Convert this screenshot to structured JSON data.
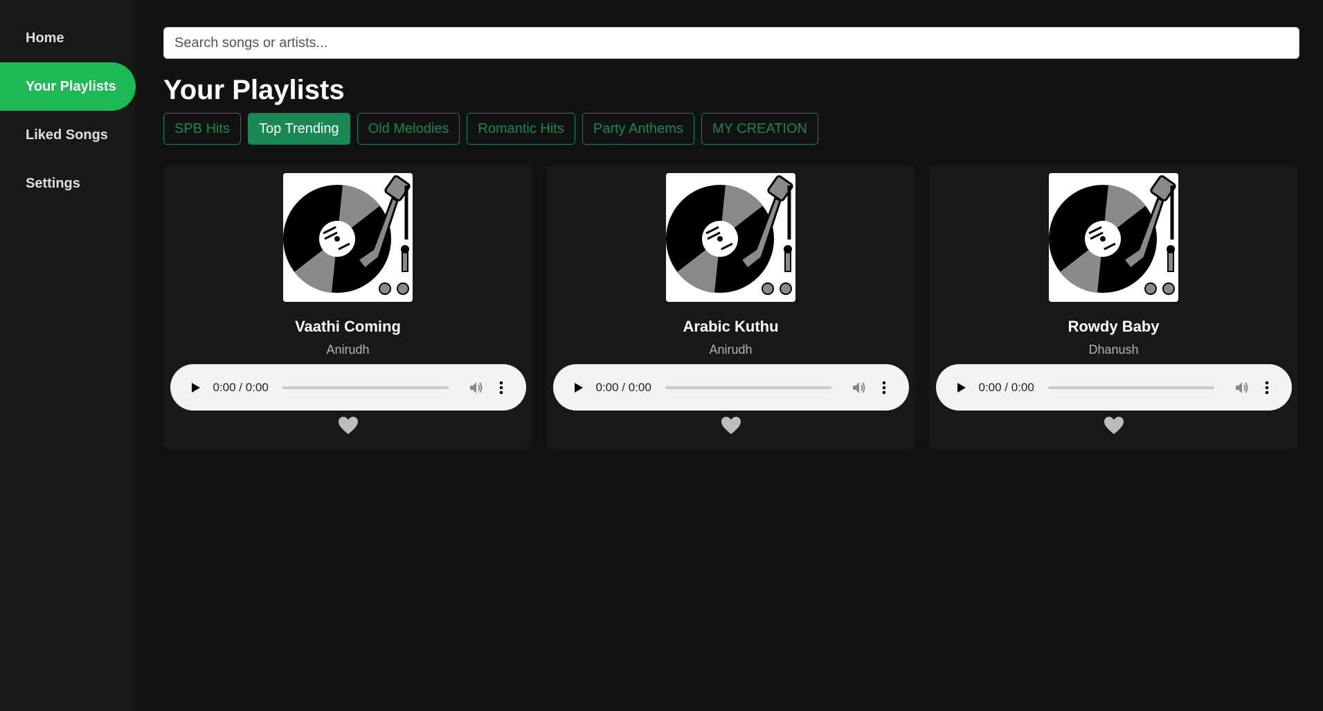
{
  "sidebar": {
    "items": [
      {
        "label": "Home",
        "active": false
      },
      {
        "label": "Your Playlists",
        "active": true
      },
      {
        "label": "Liked Songs",
        "active": false
      },
      {
        "label": "Settings",
        "active": false
      }
    ]
  },
  "search": {
    "placeholder": "Search songs or artists...",
    "value": ""
  },
  "page": {
    "title": "Your Playlists"
  },
  "playlists": [
    {
      "label": "SPB Hits",
      "active": false
    },
    {
      "label": "Top Trending",
      "active": true
    },
    {
      "label": "Old Melodies",
      "active": false
    },
    {
      "label": "Romantic Hits",
      "active": false
    },
    {
      "label": "Party Anthems",
      "active": false
    },
    {
      "label": "MY CREATION",
      "active": false
    }
  ],
  "songs": [
    {
      "title": "Vaathi Coming",
      "artist": "Anirudh",
      "time": "0:00 / 0:00",
      "cover_icon": "turntable-icon",
      "liked": false
    },
    {
      "title": "Arabic Kuthu",
      "artist": "Anirudh",
      "time": "0:00 / 0:00",
      "cover_icon": "turntable-icon",
      "liked": false
    },
    {
      "title": "Rowdy Baby",
      "artist": "Dhanush",
      "time": "0:00 / 0:00",
      "cover_icon": "turntable-icon",
      "liked": false
    }
  ],
  "colors": {
    "background": "#121212",
    "sidebar": "#181818",
    "card": "#181818",
    "accent_nav": "#1db954",
    "accent_chip": "#198754",
    "heart": "#bdbdbd"
  }
}
